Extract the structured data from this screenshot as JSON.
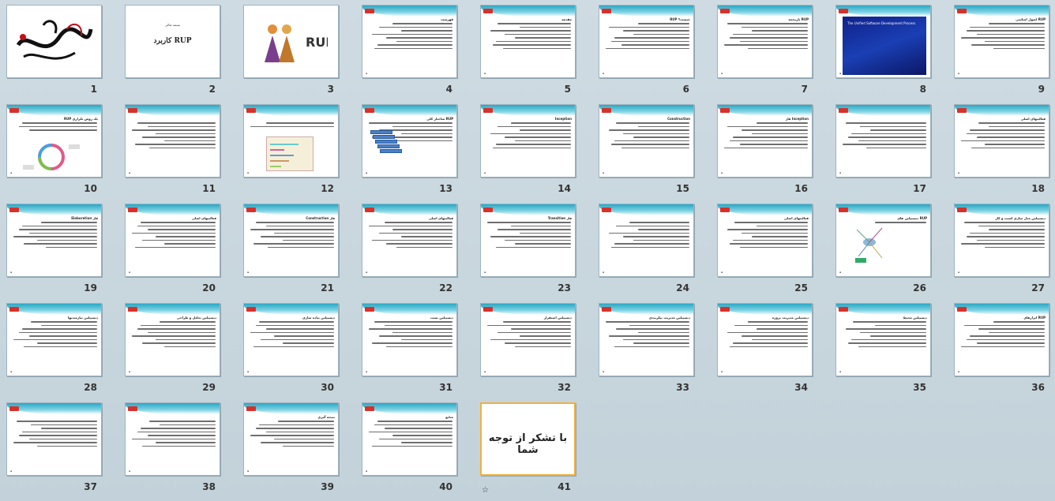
{
  "view": {
    "name": "Slide Sorter",
    "selected_slide": 41
  },
  "colors": {
    "background": "#c8d6de",
    "header_wave": "#2aa7c5",
    "badge": "#d8302a",
    "selection": "#f0b040"
  },
  "slides": [
    {
      "number": "1",
      "kind": "calligraphy"
    },
    {
      "number": "2",
      "kind": "title",
      "top_text": "بسمه تعالی",
      "title": "کاربرد RUP"
    },
    {
      "number": "3",
      "kind": "logo",
      "title": "RUP"
    },
    {
      "number": "4",
      "kind": "text",
      "heading": "فهرست"
    },
    {
      "number": "5",
      "kind": "text",
      "heading": "مقدمه"
    },
    {
      "number": "6",
      "kind": "text",
      "heading": "RUP چیست؟"
    },
    {
      "number": "7",
      "kind": "text",
      "heading": "تاریخچه RUP"
    },
    {
      "number": "8",
      "kind": "image_blue",
      "caption": "The Unified Software Development Process"
    },
    {
      "number": "9",
      "kind": "text",
      "heading": "اصول اساسی RUP"
    },
    {
      "number": "10",
      "kind": "diagram",
      "heading": "RUP یک روش تکراری"
    },
    {
      "number": "11",
      "kind": "text",
      "heading": ""
    },
    {
      "number": "12",
      "kind": "chart",
      "heading": ""
    },
    {
      "number": "13",
      "kind": "stack",
      "heading": "ساختار کلی RUP"
    },
    {
      "number": "14",
      "kind": "text",
      "heading": "Inception"
    },
    {
      "number": "15",
      "kind": "text",
      "heading": "Construction"
    },
    {
      "number": "16",
      "kind": "text",
      "heading": "فاز Inception"
    },
    {
      "number": "17",
      "kind": "text",
      "heading": ""
    },
    {
      "number": "18",
      "kind": "text",
      "heading": "فعالیتهای اصلی"
    },
    {
      "number": "19",
      "kind": "text",
      "heading": "Elaboration فاز"
    },
    {
      "number": "20",
      "kind": "text",
      "heading": "فعالیتهای اصلی"
    },
    {
      "number": "21",
      "kind": "text",
      "heading": "Construction فاز"
    },
    {
      "number": "22",
      "kind": "text",
      "heading": "فعالیتهای اصلی"
    },
    {
      "number": "23",
      "kind": "text",
      "heading": "Transition فاز"
    },
    {
      "number": "24",
      "kind": "text",
      "heading": ""
    },
    {
      "number": "25",
      "kind": "text",
      "heading": "فعالیتهای اصلی"
    },
    {
      "number": "26",
      "kind": "mind",
      "heading": "دیسیپلین های RUP"
    },
    {
      "number": "27",
      "kind": "text",
      "heading": "دیسیپلین مدل سازی کسب و کار"
    },
    {
      "number": "28",
      "kind": "text",
      "heading": "دیسیپلین نیازمندیها"
    },
    {
      "number": "29",
      "kind": "text",
      "heading": "دیسیپلین تحلیل و طراحی"
    },
    {
      "number": "30",
      "kind": "text",
      "heading": "دیسیپلین پیاده سازی"
    },
    {
      "number": "31",
      "kind": "text",
      "heading": "دیسیپلین تست"
    },
    {
      "number": "32",
      "kind": "text",
      "heading": "دیسیپلین استقرار"
    },
    {
      "number": "33",
      "kind": "text",
      "heading": "دیسیپلین مدیریت پیکربندی"
    },
    {
      "number": "34",
      "kind": "text",
      "heading": "دیسیپلین مدیریت پروژه"
    },
    {
      "number": "35",
      "kind": "text",
      "heading": "دیسیپلین محیط"
    },
    {
      "number": "36",
      "kind": "text",
      "heading": "ابزارهای RUP"
    },
    {
      "number": "37",
      "kind": "text",
      "heading": ""
    },
    {
      "number": "38",
      "kind": "text",
      "heading": ""
    },
    {
      "number": "39",
      "kind": "text",
      "heading": "نتیجه گیری"
    },
    {
      "number": "40",
      "kind": "text",
      "heading": "منابع"
    },
    {
      "number": "41",
      "kind": "thanks",
      "title": "با تشکر از توجه شما"
    }
  ],
  "footer_icon": "slide-transition-icon",
  "footer_glyph": "☆"
}
